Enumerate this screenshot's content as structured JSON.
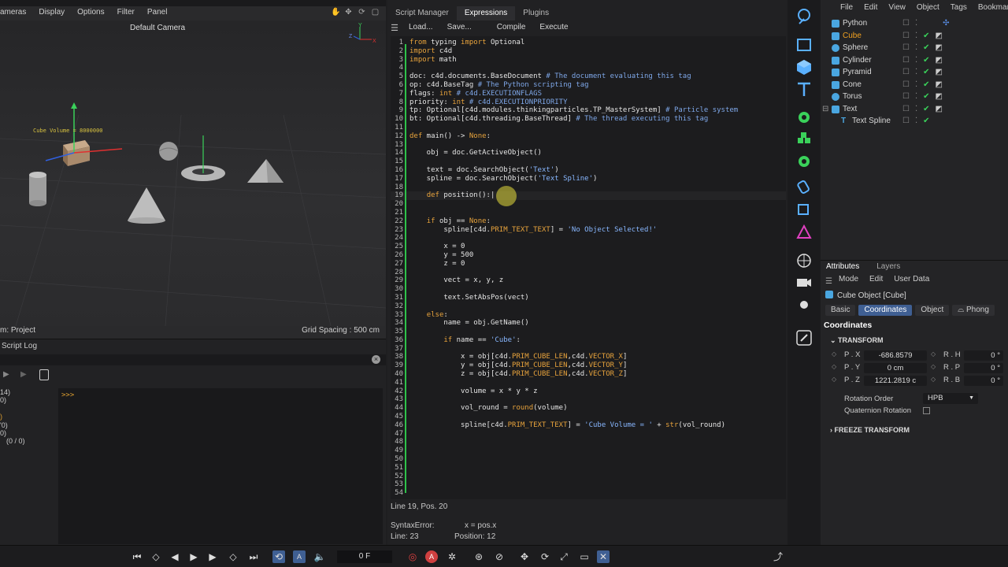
{
  "viewport": {
    "menu": [
      "ameras",
      "Display",
      "Options",
      "Filter",
      "Panel"
    ],
    "camera_label": "Default Camera",
    "status_left": "m: Project",
    "status_right": "Grid Spacing : 500 cm",
    "object_label": "Cube Volume = 8000000",
    "axis_y": "Y",
    "axis_z": "Z",
    "axis_x": "X"
  },
  "script_log": {
    "title": "Script Log",
    "prompt": ">>>",
    "left_values": [
      "14)",
      "0)",
      "",
      ")",
      "'0)",
      "0)",
      "(0 / 0)"
    ]
  },
  "script_manager": {
    "tabs": [
      "Script Manager",
      "Expressions",
      "Plugins"
    ],
    "active_tab": "Expressions",
    "toolbar": [
      "Load...",
      "Save...",
      "Compile",
      "Execute"
    ],
    "line_numbers": [
      "1",
      "2",
      "3",
      "4",
      "5",
      "6",
      "7",
      "8",
      "9",
      "10",
      "11",
      "12",
      "13",
      "14",
      "15",
      "16",
      "17",
      "18",
      "19",
      "20",
      "21",
      "22",
      "23",
      "24",
      "25",
      "26",
      "27",
      "28",
      "29",
      "30",
      "31",
      "32",
      "33",
      "34",
      "35",
      "36",
      "37",
      "38",
      "39",
      "40",
      "41",
      "42",
      "43",
      "44",
      "45",
      "46",
      "47",
      "48",
      "49",
      "50",
      "51",
      "52",
      "53",
      "54"
    ],
    "status": {
      "position": "Line 19, Pos. 20",
      "error_label": "SyntaxError:",
      "error_detail": "x = pos.x",
      "line": "Line: 23",
      "pos": "Position: 12"
    }
  },
  "object_manager": {
    "menu": [
      "File",
      "Edit",
      "View",
      "Object",
      "Tags",
      "Bookmar"
    ],
    "objects": [
      {
        "name": "Python",
        "color": "#5aa0e6"
      },
      {
        "name": "Cube",
        "color": "#4aa6e0",
        "selected": true
      },
      {
        "name": "Sphere",
        "color": "#4aa6e0"
      },
      {
        "name": "Cylinder",
        "color": "#4aa6e0"
      },
      {
        "name": "Pyramid",
        "color": "#4aa6e0"
      },
      {
        "name": "Cone",
        "color": "#4aa6e0"
      },
      {
        "name": "Torus",
        "color": "#4aa6e0"
      },
      {
        "name": "Text",
        "color": "#4aa6e0"
      },
      {
        "name": "Text Spline",
        "color": "#4aa6e0"
      }
    ]
  },
  "attributes": {
    "tabs": [
      "Attributes",
      "Layers"
    ],
    "menu": [
      "Mode",
      "Edit",
      "User Data"
    ],
    "object_title": "Cube Object [Cube]",
    "subtabs": [
      "Basic",
      "Coordinates",
      "Object",
      "Phong"
    ],
    "active_subtab": "Coordinates",
    "section": "Coordinates",
    "transform": "TRANSFORM",
    "rows": [
      {
        "label": "P . X",
        "value": "-686.8579",
        "rlabel": "R . H",
        "rvalue": "0 °"
      },
      {
        "label": "P . Y",
        "value": "0 cm",
        "rlabel": "R . P",
        "rvalue": "0 °"
      },
      {
        "label": "P . Z",
        "value": "1221.2819 c",
        "rlabel": "R . B",
        "rvalue": "0 °"
      }
    ],
    "rotation_order_label": "Rotation Order",
    "rotation_order_value": "HPB",
    "quaternion_label": "Quaternion Rotation",
    "freeze": "FREEZE TRANSFORM"
  },
  "timeline": {
    "frame": "0 F"
  },
  "colors": {
    "accent": "#3f5f93",
    "green_bar": "#2ec24a",
    "keyword": "#e8a33c",
    "comment": "#7ea7e8"
  }
}
